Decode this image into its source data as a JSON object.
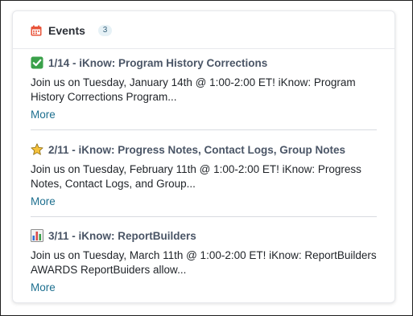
{
  "widget": {
    "title": "Events",
    "count": "3",
    "icon": "calendar-icon",
    "accent_color": "#e8543a",
    "link_color": "#1d6f8f"
  },
  "events": [
    {
      "icon": "check-mark-button-icon",
      "title": "1/14 - iKnow: Program History Corrections",
      "description": "Join us on Tuesday, January 14th @ 1:00-2:00 ET! iKnow: Program History Corrections Program...",
      "more_label": "More"
    },
    {
      "icon": "star-icon",
      "title": "2/11 - iKnow: Progress Notes, Contact Logs, Group Notes",
      "description": "Join us on Tuesday, February 11th @ 1:00-2:00 ET! iKnow: Progress Notes, Contact Logs, and Group...",
      "more_label": "More"
    },
    {
      "icon": "bar-chart-icon",
      "title": "3/11 - iKnow: ReportBuilders",
      "description": "Join us on Tuesday, March 11th @ 1:00-2:00 ET! iKnow: ReportBuilders AWARDS ReportBuiders allow...",
      "more_label": "More"
    }
  ]
}
